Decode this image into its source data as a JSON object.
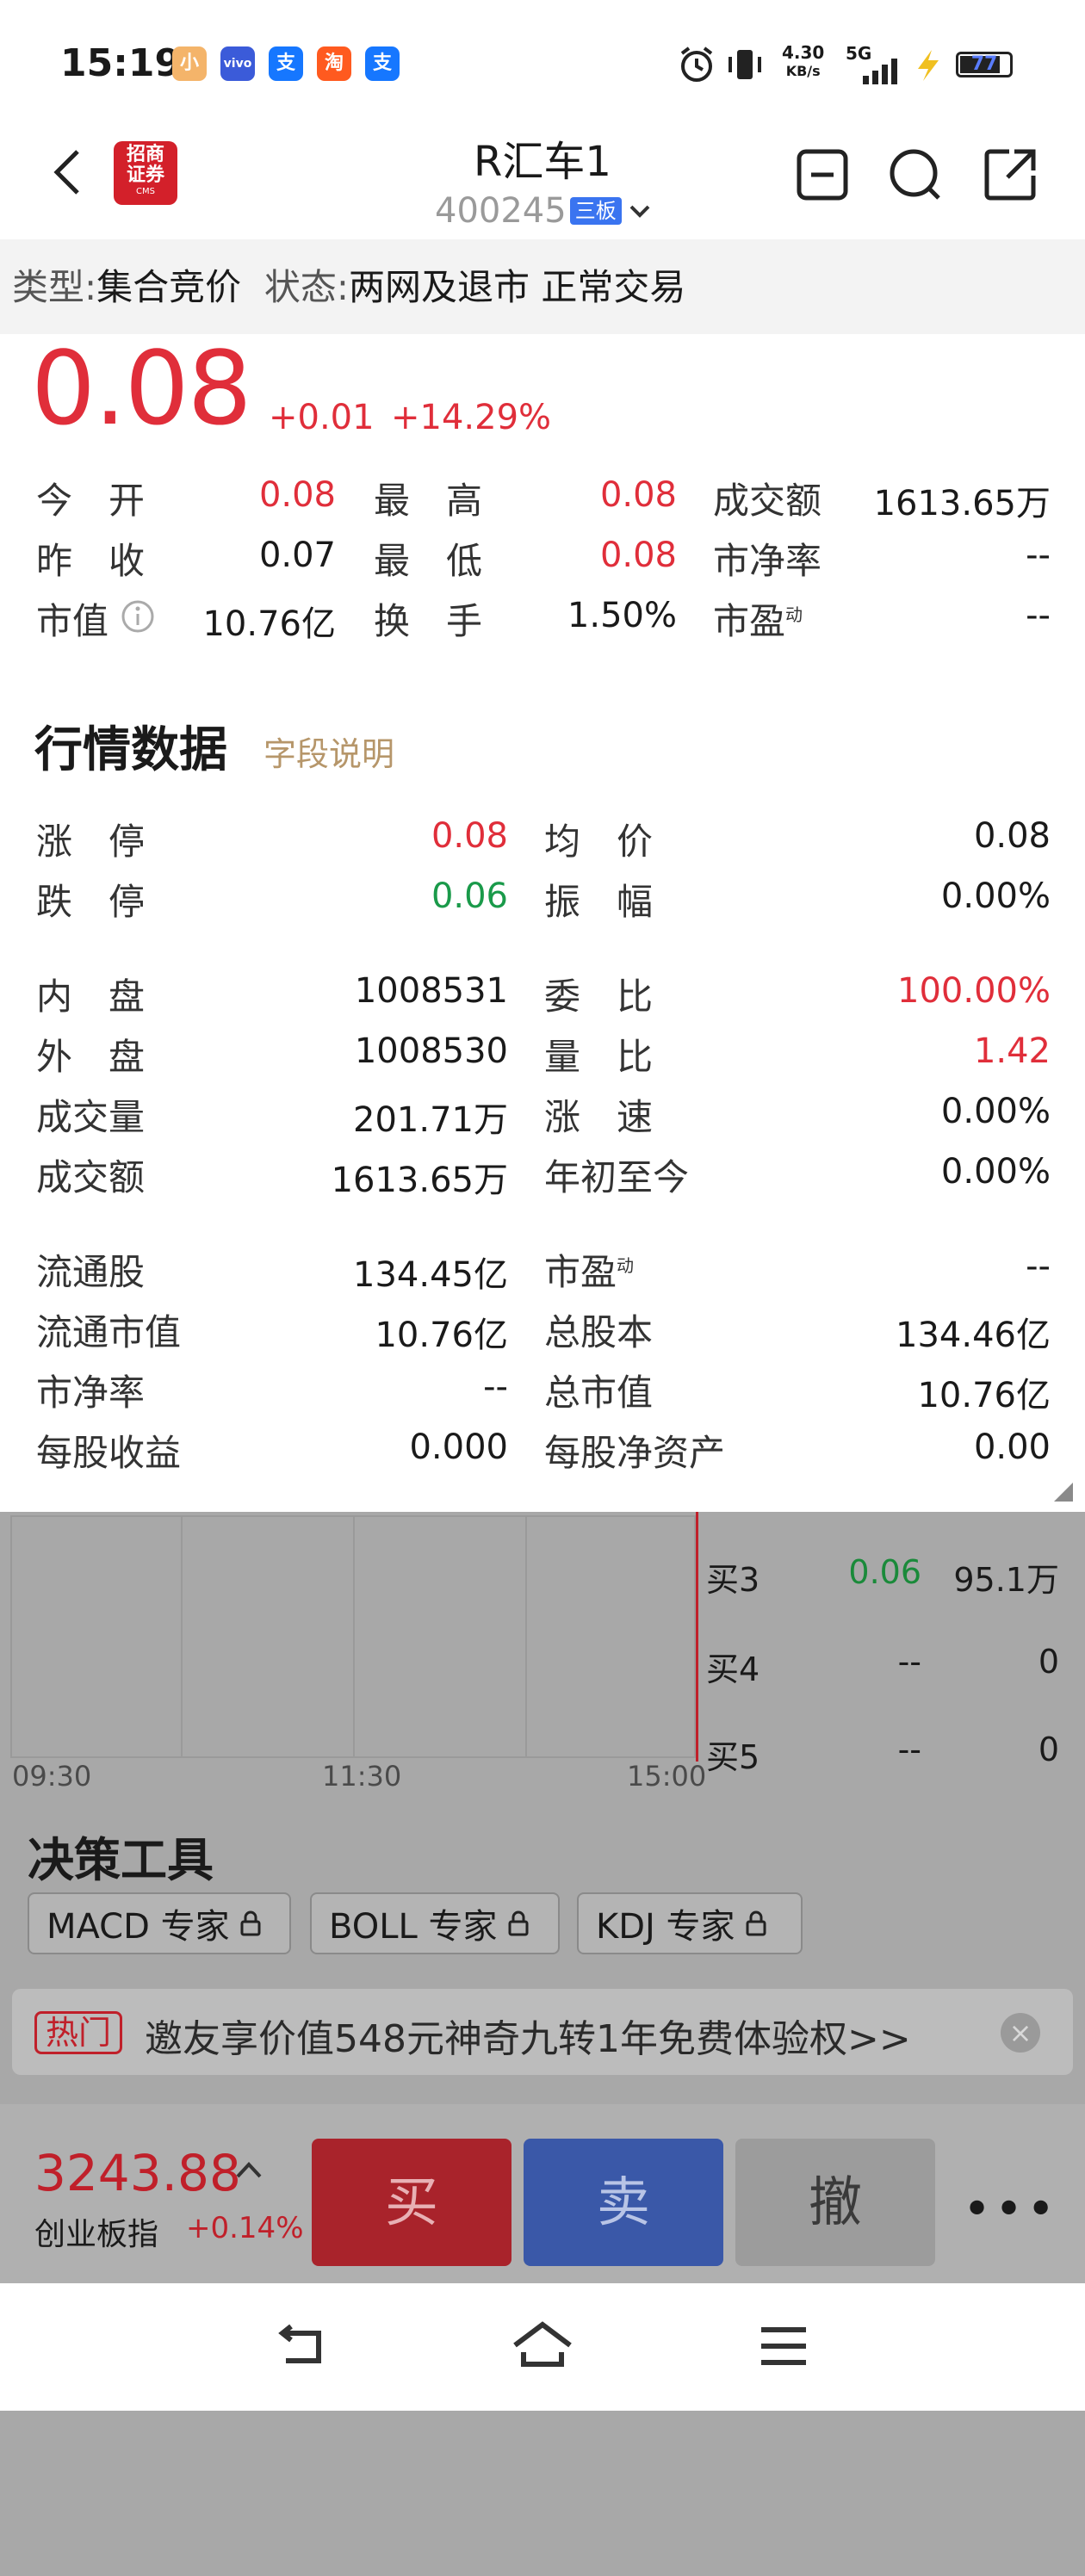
{
  "status_bar": {
    "time": "15:19",
    "net_speed": "4.30",
    "net_unit": "KB/s",
    "network": "5G",
    "battery": "77",
    "notif_apps": [
      "小",
      "vivo",
      "支",
      "淘",
      "支"
    ]
  },
  "header": {
    "stock_name": "R汇车1",
    "stock_code": "400245",
    "board_badge": "三板",
    "logo_line1": "招商",
    "logo_line2": "证券",
    "logo_cms": "CMS"
  },
  "type_strip": {
    "type_label": "类型:",
    "type_value": "集合竞价",
    "status_label": "状态:",
    "status_value": "两网及退市 正常交易"
  },
  "price": {
    "last": "0.08",
    "change": "+0.01",
    "change_pct": "+14.29%"
  },
  "summary": [
    {
      "l1": "今　开",
      "v1": "0.08",
      "l2": "最　高",
      "v2": "0.08",
      "l3": "成交额",
      "v3": "1613.65万"
    },
    {
      "l1": "昨　收",
      "v1": "0.07",
      "l2": "最　低",
      "v2": "0.08",
      "l3": "市净率",
      "v3": "--"
    },
    {
      "l1": "市值",
      "v1": "10.76亿",
      "l2": "换　手",
      "v2": "1.50%",
      "l3": "市盈",
      "l3_sup": "动",
      "v3": "--"
    }
  ],
  "market_data": {
    "title": "行情数据",
    "link": "字段说明",
    "rows": [
      {
        "l1": "涨　停",
        "v1": "0.08",
        "l2": "均　价",
        "v2": "0.08"
      },
      {
        "l1": "跌　停",
        "v1": "0.06",
        "l2": "振　幅",
        "v2": "0.00%"
      },
      {
        "l1": "内　盘",
        "v1": "1008531",
        "l2": "委　比",
        "v2": "100.00%"
      },
      {
        "l1": "外　盘",
        "v1": "1008530",
        "l2": "量　比",
        "v2": "1.42"
      },
      {
        "l1": "成交量",
        "v1": "201.71万",
        "l2": "涨　速",
        "v2": "0.00%"
      },
      {
        "l1": "成交额",
        "v1": "1613.65万",
        "l2": "年初至今",
        "v2": "0.00%"
      },
      {
        "l1": "流通股",
        "v1": "134.45亿",
        "l2": "市盈",
        "l2_sup": "动",
        "v2": "--"
      },
      {
        "l1": "流通市值",
        "v1": "10.76亿",
        "l2": "总股本",
        "v2": "134.46亿"
      },
      {
        "l1": "市净率",
        "v1": "--",
        "l2": "总市值",
        "v2": "10.76亿"
      },
      {
        "l1": "每股收益",
        "v1": "0.000",
        "l2": "每股净资产",
        "v2": "0.00"
      }
    ]
  },
  "chart": {
    "time_labels": [
      "09:30",
      "11:30",
      "15:00"
    ]
  },
  "order_book": [
    {
      "label": "买3",
      "price": "0.06",
      "vol": "95.1万"
    },
    {
      "label": "买4",
      "price": "--",
      "vol": "0"
    },
    {
      "label": "买5",
      "price": "--",
      "vol": "0"
    }
  ],
  "tools": {
    "title": "决策工具",
    "chips": [
      "MACD 专家",
      "BOLL 专家",
      "KDJ 专家"
    ]
  },
  "promo": {
    "tag": "热门",
    "text": "邀友享价值548元神奇九转1年免费体验权>>"
  },
  "bottom": {
    "index_price": "3243.88",
    "index_name": "创业板指",
    "index_change": "+0.14%",
    "buy": "买",
    "sell": "卖",
    "cancel": "撤",
    "more": "•••"
  },
  "colors": {
    "up": "#e02e3a",
    "down": "#1a9a4a",
    "accent_gold": "#b6966a",
    "badge_blue": "#3a74f0"
  }
}
